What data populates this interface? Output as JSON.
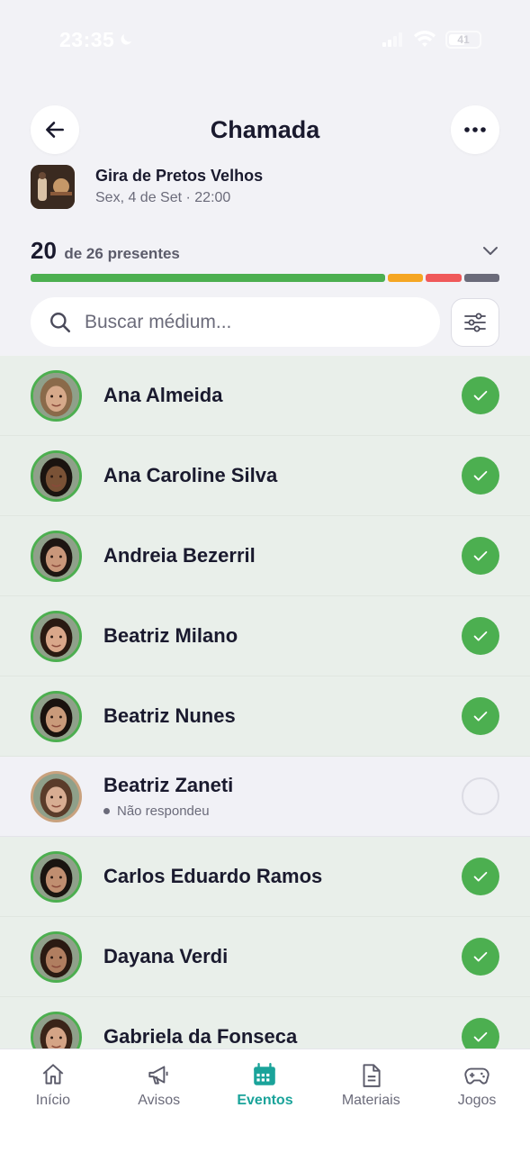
{
  "status_bar": {
    "time": "23:35",
    "battery": "41"
  },
  "header": {
    "title": "Chamada"
  },
  "event": {
    "name": "Gira de Pretos Velhos",
    "date": "Sex, 4 de Set · 22:00"
  },
  "attendance": {
    "present": "20",
    "label": "de 26 presentes",
    "breakdown": [
      {
        "status": "present",
        "count": 20,
        "color": "#4caf50"
      },
      {
        "status": "late",
        "count": 2,
        "color": "#f5a623"
      },
      {
        "status": "absent",
        "count": 2,
        "color": "#f0595a"
      },
      {
        "status": "no_response",
        "count": 2,
        "color": "#6b6b7a"
      }
    ]
  },
  "search": {
    "placeholder": "Buscar médium..."
  },
  "members": [
    {
      "name": "Ana Almeida",
      "present": true,
      "skin": "#d6a98a",
      "hair": "#8a6a4a"
    },
    {
      "name": "Ana Caroline Silva",
      "present": true,
      "skin": "#7a5236",
      "hair": "#1b1410"
    },
    {
      "name": "Andreia Bezerril",
      "present": true,
      "skin": "#c9977a",
      "hair": "#1e1612"
    },
    {
      "name": "Beatriz Milano",
      "present": true,
      "skin": "#d9a78a",
      "hair": "#2a1a12"
    },
    {
      "name": "Beatriz Nunes",
      "present": true,
      "skin": "#c99a7a",
      "hair": "#1a120e"
    },
    {
      "name": "Beatriz Zaneti",
      "present": false,
      "status": "Não respondeu",
      "skin": "#d7ad92",
      "hair": "#5a3c2a"
    },
    {
      "name": "Carlos Eduardo Ramos",
      "present": true,
      "skin": "#c08e70",
      "hair": "#1a1410"
    },
    {
      "name": "Dayana Verdi",
      "present": true,
      "skin": "#b07e60",
      "hair": "#2a1a12"
    },
    {
      "name": "Gabriela da Fonseca",
      "present": true,
      "skin": "#d4a486",
      "hair": "#3a2418"
    }
  ],
  "tabs": [
    {
      "label": "Início",
      "icon": "home-icon",
      "active": false
    },
    {
      "label": "Avisos",
      "icon": "megaphone-icon",
      "active": false
    },
    {
      "label": "Eventos",
      "icon": "calendar-icon",
      "active": true
    },
    {
      "label": "Materiais",
      "icon": "document-icon",
      "active": false
    },
    {
      "label": "Jogos",
      "icon": "gamepad-icon",
      "active": false
    }
  ],
  "colors": {
    "accent": "#1aa39a",
    "present": "#4caf50",
    "row_present_bg": "#e9efea"
  }
}
